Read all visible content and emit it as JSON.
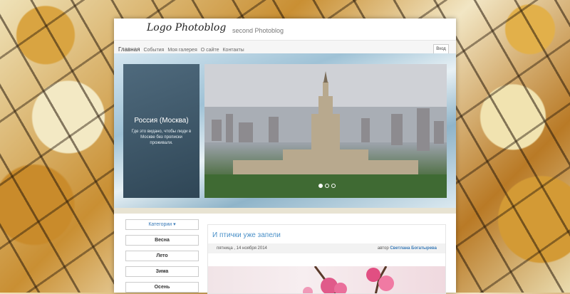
{
  "header": {
    "logo": "Logo Photoblog",
    "site_name": "second Photoblog"
  },
  "nav": {
    "home": "Главная",
    "items": [
      "События",
      "Моя галерея",
      "О сайте",
      "Контакты"
    ],
    "login": "Вход"
  },
  "slider": {
    "caption_title": "Россия (Москва)",
    "caption_text": "Где это видано, чтобы люди в Москве без прописки проживали.",
    "dots": 3,
    "active_dot": 1
  },
  "sidebar": {
    "category_dropdown": "Категории",
    "categories": [
      "Весна",
      "Лето",
      "Зима",
      "Осень"
    ]
  },
  "post": {
    "title": "И птички уже запели",
    "date": "пятница , 14 ноября 2014",
    "author_prefix": "автор",
    "author_name": "Светлана Богатырева"
  },
  "colors": {
    "link": "#3a7bb8",
    "post_title": "#4a90c8"
  }
}
